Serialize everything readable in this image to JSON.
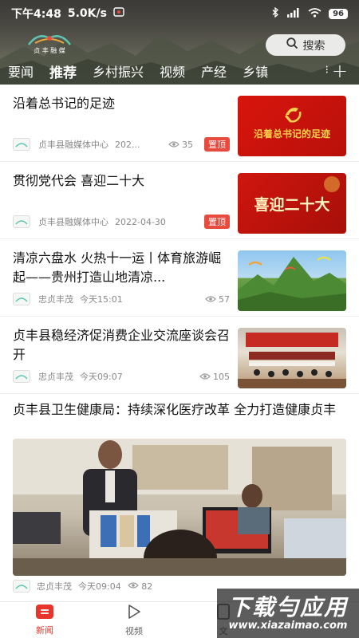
{
  "status_bar": {
    "time": "下午4:48",
    "network_speed": "5.0K/s",
    "battery": "96"
  },
  "header": {
    "logo_text": "贞 丰 融 媒",
    "search_label": "搜索",
    "tabs": [
      {
        "label": "要闻"
      },
      {
        "label": "推荐"
      },
      {
        "label": "乡村振兴"
      },
      {
        "label": "视频"
      },
      {
        "label": "产经"
      },
      {
        "label": "乡镇"
      }
    ],
    "more_label": "⁝",
    "add_label": "+"
  },
  "feed": {
    "items": [
      {
        "title": "沿着总书记的足迹",
        "source": "贞丰县融媒体中心",
        "date": "202...",
        "views": "35",
        "tag": "置顶",
        "thumb_text": "沿着总书记的足迹"
      },
      {
        "title": "贯彻党代会 喜迎二十大",
        "source": "贞丰县融媒体中心",
        "date": "2022-04-30",
        "tag": "置顶",
        "thumb_text": "喜迎二十大"
      },
      {
        "title": "清凉六盘水 火热十一运丨体育旅游崛起——贵州打造山地清凉...",
        "source": "忠贞丰茂",
        "date": "今天15:01",
        "views": "57"
      },
      {
        "title": "贞丰县稳经济促消费企业交流座谈会召开",
        "source": "忠贞丰茂",
        "date": "今天09:07",
        "views": "105"
      }
    ],
    "featured": {
      "title": "贞丰县卫生健康局：持续深化医疗改革 全力打造健康贞丰",
      "source": "忠贞丰茂",
      "date": "今天09:04",
      "views": "82"
    }
  },
  "bottom_nav": {
    "items": [
      {
        "label": "新闻"
      },
      {
        "label": "视频"
      },
      {
        "label": "文"
      }
    ]
  },
  "watermark": {
    "main": "下载勻应用",
    "url": "www.xiazaimao.com"
  },
  "colors": {
    "accent": "#e8352b",
    "tag_bg": "#e84a3d"
  }
}
